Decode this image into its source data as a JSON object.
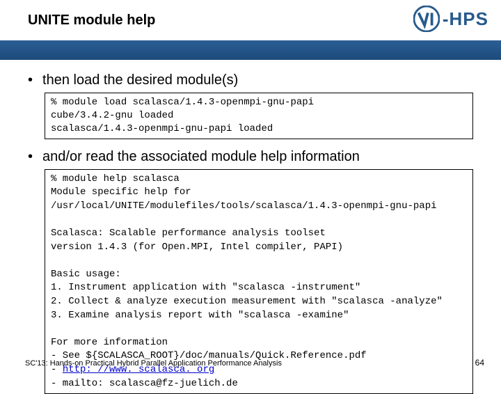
{
  "header": {
    "title": "UNITE module help",
    "logo_text": "-HPS"
  },
  "bullets": {
    "b1": "then load the desired module(s)",
    "b2": "and/or read the associated module help information"
  },
  "code1": "% module load scalasca/1.4.3-openmpi-gnu-papi\ncube/3.4.2-gnu loaded\nscalasca/1.4.3-openmpi-gnu-papi loaded",
  "code2": {
    "p1": "% module help scalasca\nModule specific help for\n/usr/local/UNITE/modulefiles/tools/scalasca/1.4.3-openmpi-gnu-papi",
    "p2": "Scalasca: Scalable performance analysis toolset\nversion 1.4.3 (for Open.MPI, Intel compiler, PAPI)",
    "p3": "Basic usage:\n1. Instrument application with \"scalasca -instrument\"\n2. Collect & analyze execution measurement with \"scalasca -analyze\"\n3. Examine analysis report with \"scalasca -examine\"",
    "p4a": "For more information\n- See ${SCALASCA_ROOT}/doc/manuals/Quick.Reference.pdf\n- ",
    "link": "http: //www. scalasca. org",
    "p4b": "\n- mailto: scalasca@fz-juelich.de"
  },
  "footer": {
    "left": "SC'13: Hands-on Practical Hybrid Parallel Application Performance Analysis",
    "right": "64"
  }
}
